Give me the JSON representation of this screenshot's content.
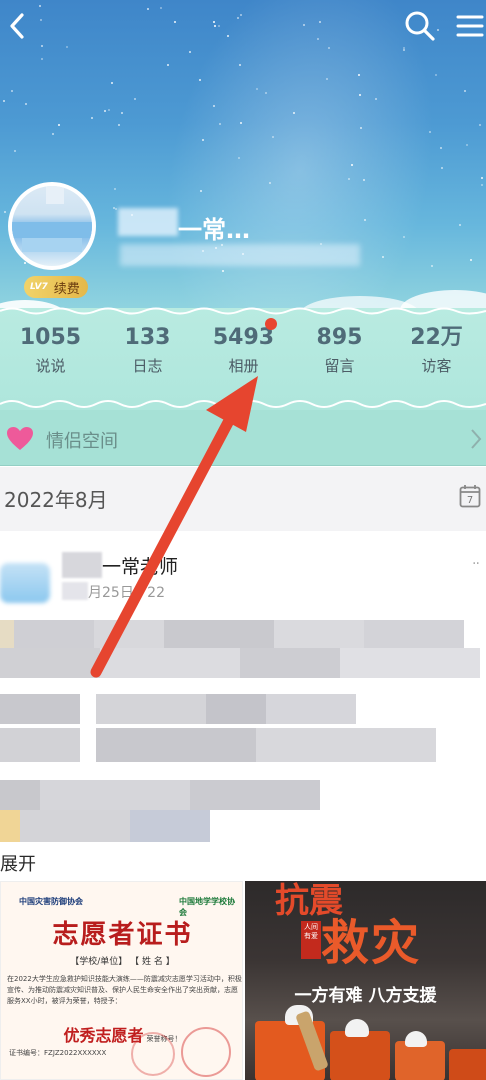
{
  "profile": {
    "name_suffix": "一常…",
    "vip_level": "LV7",
    "vip_action": "续费"
  },
  "stats": [
    {
      "value": "1055",
      "label": "说说"
    },
    {
      "value": "133",
      "label": "日志"
    },
    {
      "value": "5493",
      "label": "相册"
    },
    {
      "value": "895",
      "label": "留言"
    },
    {
      "value": "22万",
      "label": "访客"
    }
  ],
  "couple_space": {
    "label": "情侣空间"
  },
  "timeline": {
    "month": "2022年8月",
    "calendar_day": "7"
  },
  "post": {
    "author_suffix": "一常老师",
    "date_fragment": "月25日1  22",
    "more": "··",
    "expand": "展开"
  },
  "certificate": {
    "org_left": "中国灾害防御协会",
    "org_right": "中国地学学校协会",
    "title": "志愿者证书",
    "fields": "【学校/单位】        【 姓 名 】",
    "body": "在2022大学生应急救护知识技能大演练——防震减灾志愿学习活动中，积极宣传、为推动防震减灾知识普及、保护人民生命安全作出了突出贡献，志愿服务XX小时，被评为荣誉，特授予：",
    "award": "优秀志愿者",
    "award_note": "荣誉称号！",
    "cert_no": "证书编号：FZJZ2022XXXXXX"
  },
  "poster": {
    "top_text": "抗震",
    "main_text": "救灾",
    "seal_text": "人间有爱",
    "slogan": "一方有难 八方支援"
  }
}
